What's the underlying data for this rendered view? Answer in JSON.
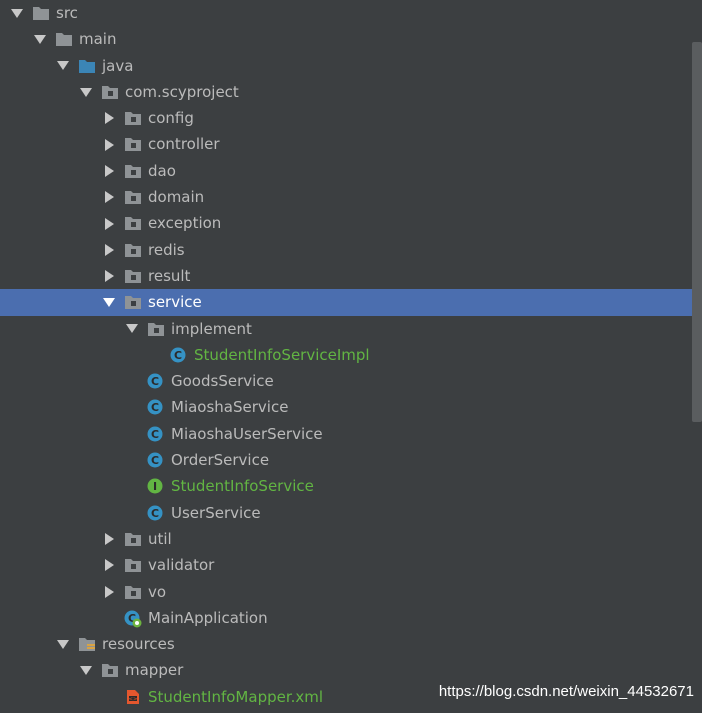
{
  "tree": {
    "nodes": [
      {
        "label": "src",
        "depth": 0,
        "expanded": true,
        "icon": "folder-icon"
      },
      {
        "label": "main",
        "depth": 1,
        "expanded": true,
        "icon": "folder-icon"
      },
      {
        "label": "java",
        "depth": 2,
        "expanded": true,
        "icon": "source-folder-icon"
      },
      {
        "label": "com.scyproject",
        "depth": 3,
        "expanded": true,
        "icon": "package-icon"
      },
      {
        "label": "config",
        "depth": 4,
        "expanded": false,
        "icon": "package-icon"
      },
      {
        "label": "controller",
        "depth": 4,
        "expanded": false,
        "icon": "package-icon"
      },
      {
        "label": "dao",
        "depth": 4,
        "expanded": false,
        "icon": "package-icon"
      },
      {
        "label": "domain",
        "depth": 4,
        "expanded": false,
        "icon": "package-icon"
      },
      {
        "label": "exception",
        "depth": 4,
        "expanded": false,
        "icon": "package-icon"
      },
      {
        "label": "redis",
        "depth": 4,
        "expanded": false,
        "icon": "package-icon"
      },
      {
        "label": "result",
        "depth": 4,
        "expanded": false,
        "icon": "package-icon"
      },
      {
        "label": "service",
        "depth": 4,
        "expanded": true,
        "icon": "package-icon",
        "selected": true
      },
      {
        "label": "implement",
        "depth": 5,
        "expanded": true,
        "icon": "package-icon"
      },
      {
        "label": "StudentInfoServiceImpl",
        "depth": 6,
        "icon": "class-icon",
        "green": true
      },
      {
        "label": "GoodsService",
        "depth": 5,
        "icon": "class-icon"
      },
      {
        "label": "MiaoshaService",
        "depth": 5,
        "icon": "class-icon"
      },
      {
        "label": "MiaoshaUserService",
        "depth": 5,
        "icon": "class-icon"
      },
      {
        "label": "OrderService",
        "depth": 5,
        "icon": "class-icon"
      },
      {
        "label": "StudentInfoService",
        "depth": 5,
        "icon": "interface-icon",
        "green": true
      },
      {
        "label": "UserService",
        "depth": 5,
        "icon": "class-icon"
      },
      {
        "label": "util",
        "depth": 4,
        "expanded": false,
        "icon": "package-icon"
      },
      {
        "label": "validator",
        "depth": 4,
        "expanded": false,
        "icon": "package-icon"
      },
      {
        "label": "vo",
        "depth": 4,
        "expanded": false,
        "icon": "package-icon"
      },
      {
        "label": "MainApplication",
        "depth": 4,
        "icon": "spring-boot-class-icon"
      },
      {
        "label": "resources",
        "depth": 2,
        "expanded": true,
        "icon": "resources-folder-icon"
      },
      {
        "label": "mapper",
        "depth": 3,
        "expanded": true,
        "icon": "package-icon"
      },
      {
        "label": "StudentInfoMapper.xml",
        "depth": 4,
        "icon": "xml-file-icon",
        "green": true
      }
    ]
  },
  "colors": {
    "background": "#3c3f41",
    "selection": "#4b6eaf",
    "text": "#bbbbbb",
    "vcs_added": "#62b543",
    "class_icon": "#3592c4",
    "interface_icon": "#62b543"
  },
  "watermark": "https://blog.csdn.net/weixin_44532671"
}
